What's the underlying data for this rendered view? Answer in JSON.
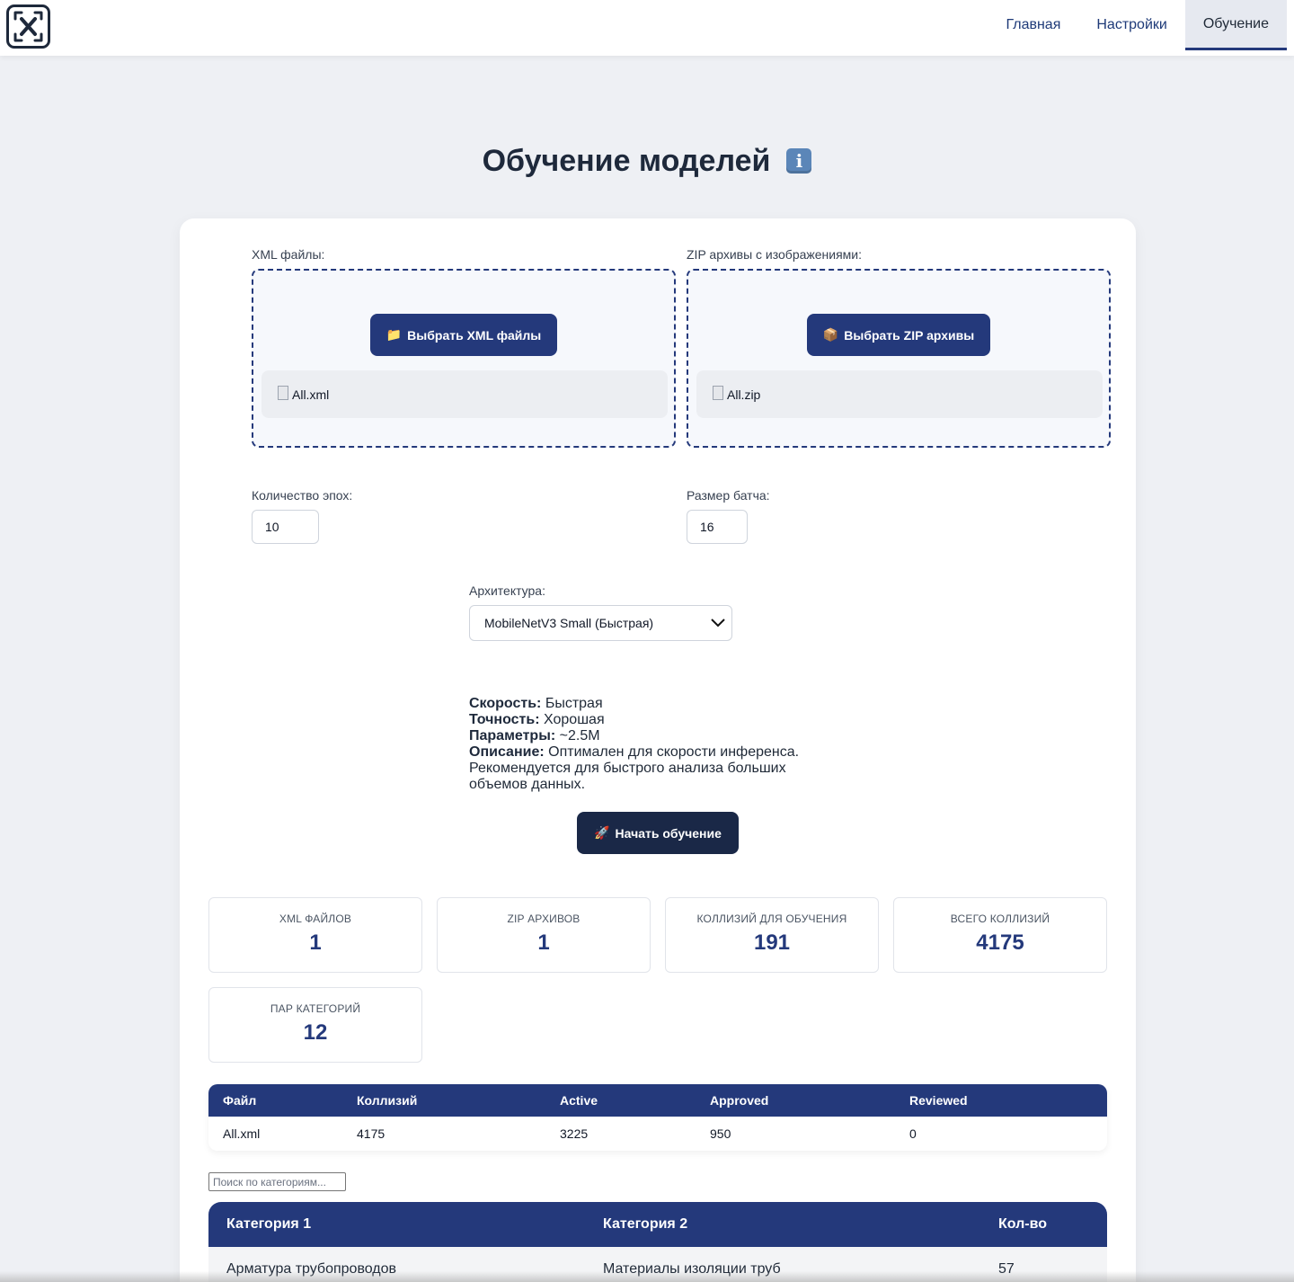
{
  "header": {
    "nav": [
      {
        "label": "Главная"
      },
      {
        "label": "Настройки"
      },
      {
        "label": "Обучение"
      }
    ]
  },
  "page": {
    "title": "Обучение моделей",
    "title_icon": "info-icon"
  },
  "upload": {
    "xml": {
      "label": "XML файлы:",
      "button_icon": "📁",
      "button_label": "Выбрать XML файлы",
      "files": [
        "All.xml"
      ]
    },
    "zip": {
      "label": "ZIP архивы с изображениями:",
      "button_icon": "📦",
      "button_label": "Выбрать ZIP архивы",
      "files": [
        "All.zip"
      ]
    }
  },
  "params": {
    "epochs_label": "Количество эпох:",
    "epochs_value": "10",
    "batch_label": "Размер батча:",
    "batch_value": "16",
    "arch_label": "Архитектура:",
    "arch_selected": "MobileNetV3 Small (Быстрая)"
  },
  "arch_info": {
    "speed_label": "Скорость:",
    "speed_value": "Быстрая",
    "accuracy_label": "Точность:",
    "accuracy_value": "Хорошая",
    "params_label": "Параметры:",
    "params_value": "~2.5M",
    "desc_label": "Описание:",
    "desc_value": "Оптимален для скорости инференса. Рекомендуется для быстрого анализа больших объемов данных."
  },
  "start": {
    "icon": "🚀",
    "label": "Начать обучение"
  },
  "stats": [
    {
      "label": "XML ФАЙЛОВ",
      "value": "1"
    },
    {
      "label": "ZIP АРХИВОВ",
      "value": "1"
    },
    {
      "label": "КОЛЛИЗИЙ ДЛЯ ОБУЧЕНИЯ",
      "value": "191"
    },
    {
      "label": "ВСЕГО КОЛЛИЗИЙ",
      "value": "4175"
    },
    {
      "label": "ПАР КАТЕГОРИЙ",
      "value": "12"
    }
  ],
  "file_table": {
    "headers": [
      "Файл",
      "Коллизий",
      "Active",
      "Approved",
      "Reviewed"
    ],
    "rows": [
      [
        "All.xml",
        "4175",
        "3225",
        "950",
        "0"
      ]
    ]
  },
  "category_search": {
    "placeholder": "Поиск по категориям..."
  },
  "category_table": {
    "headers": [
      "Категория 1",
      "Категория 2",
      "Кол-во"
    ],
    "rows": [
      [
        "Арматура трубопроводов",
        "Материалы изоляции труб",
        "57"
      ]
    ]
  },
  "colors": {
    "primary": "#24397b",
    "dark_button": "#1a2847",
    "background": "#eef0f4"
  }
}
